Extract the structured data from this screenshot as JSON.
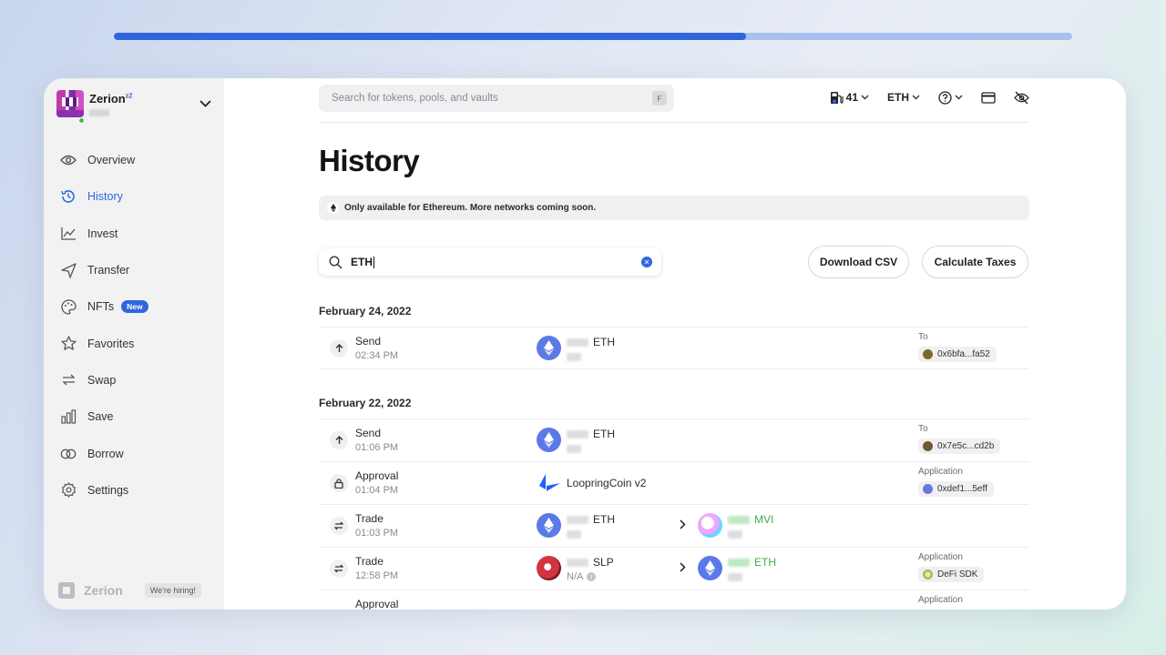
{
  "progress": {
    "fraction": 0.66
  },
  "account": {
    "name": "Zerion",
    "sleep_mark": "zZ"
  },
  "sidebar": {
    "items": [
      {
        "label": "Overview",
        "icon": "eye-icon"
      },
      {
        "label": "History",
        "icon": "history-clock-icon",
        "active": true
      },
      {
        "label": "Invest",
        "icon": "chart-line-icon"
      },
      {
        "label": "Transfer",
        "icon": "send-plane-icon"
      },
      {
        "label": "NFTs",
        "icon": "palette-icon",
        "badge": "New"
      },
      {
        "label": "Favorites",
        "icon": "star-icon"
      },
      {
        "label": "Swap",
        "icon": "swap-icon"
      },
      {
        "label": "Save",
        "icon": "bar-chart-icon"
      },
      {
        "label": "Borrow",
        "icon": "borrow-icon"
      },
      {
        "label": "Settings",
        "icon": "gear-icon"
      }
    ],
    "footer": {
      "brand": "Zerion",
      "hiring": "We're hiring!"
    }
  },
  "topbar": {
    "search_placeholder": "Search for tokens, pools, and vaults",
    "search_shortcut": "F",
    "gas": "41",
    "currency": "ETH"
  },
  "page": {
    "title": "History",
    "notice": "Only available for Ethereum. More networks coming soon.",
    "filter_value": "ETH",
    "download_csv": "Download CSV",
    "calculate_taxes": "Calculate Taxes"
  },
  "groups": [
    {
      "date": "February 24, 2022",
      "rows": [
        {
          "type": "Send",
          "time": "02:34 PM",
          "asset": "ETH",
          "cp_label": "To",
          "cp_value": "0x6bfa...fa52"
        }
      ]
    },
    {
      "date": "February 22, 2022",
      "rows": [
        {
          "type": "Send",
          "time": "01:06 PM",
          "asset": "ETH",
          "cp_label": "To",
          "cp_value": "0x7e5c...cd2b"
        },
        {
          "type": "Approval",
          "time": "01:04 PM",
          "asset": "LoopringCoin v2",
          "cp_label": "Application",
          "cp_value": "0xdef1...5eff"
        },
        {
          "type": "Trade",
          "time": "01:03 PM",
          "asset": "ETH",
          "to_asset": "MVI"
        },
        {
          "type": "Trade",
          "time": "12:58 PM",
          "asset": "SLP",
          "sub": "N/A",
          "to_asset": "ETH",
          "cp_label": "Application",
          "cp_value": "DeFi SDK"
        },
        {
          "type": "Approval",
          "cp_label": "Application"
        }
      ]
    }
  ],
  "colors": {
    "accent": "#2f66dd",
    "success": "#3bb14a",
    "eth": "#5b7ae8"
  }
}
